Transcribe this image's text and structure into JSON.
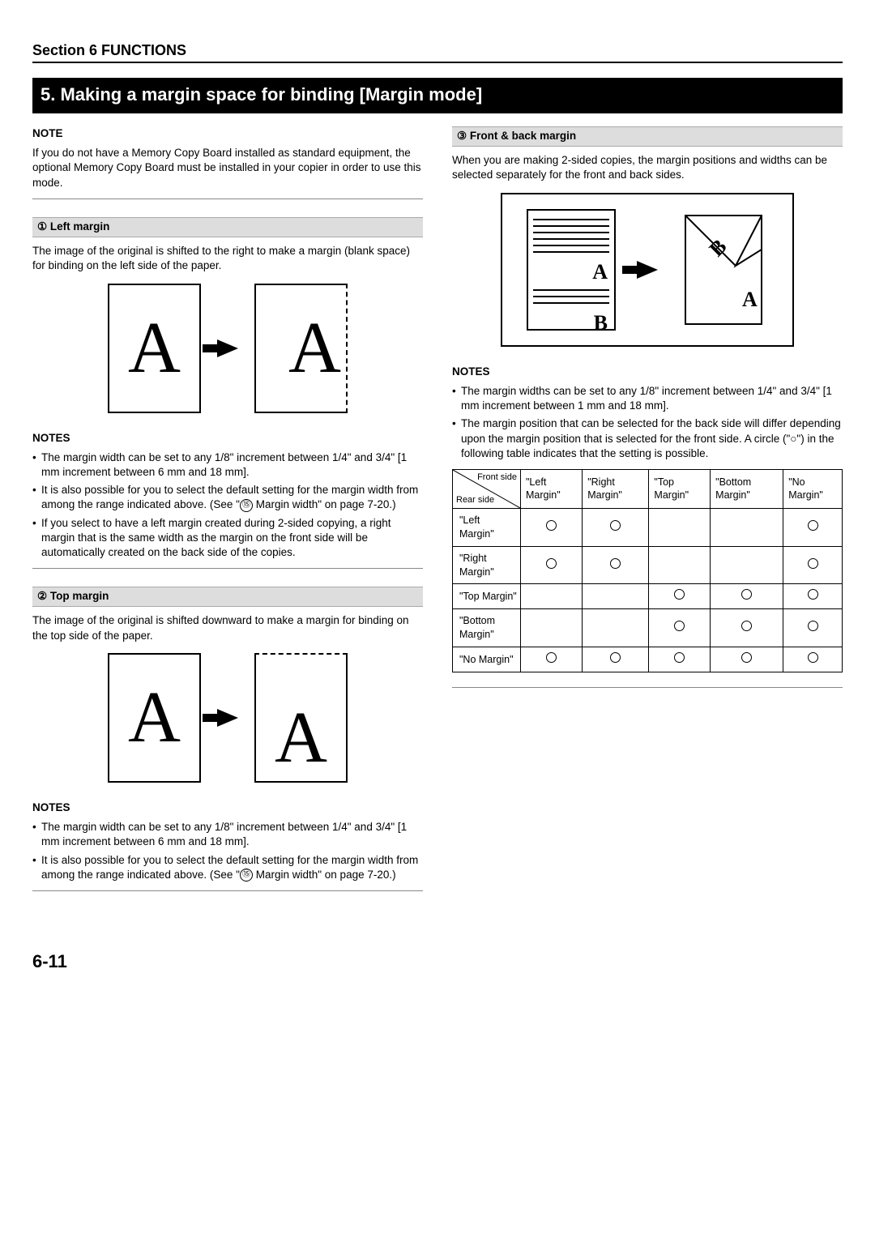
{
  "header": {
    "section": "Section 6  FUNCTIONS"
  },
  "title": "5.   Making a margin space for binding [Margin mode]",
  "left": {
    "note_head": "NOTE",
    "note_body": "If you do not have a Memory Copy Board installed as standard equipment, the optional Memory Copy Board must be installed in your copier in order to use this mode.",
    "s1_title": "①  Left margin",
    "s1_body": "The image of the original is shifted to the right to make a margin (blank space) for binding on the left side of the paper.",
    "s1_notes_head": "NOTES",
    "s1_n1": "The margin width can be set to any 1/8\" increment between 1/4\" and 3/4\" [1 mm increment between 6 mm and 18 mm].",
    "s1_n2a": "It is also possible for you to select the default setting for the margin width from among the range indicated above. (See \"",
    "s1_n2_ref": "⑮",
    "s1_n2b": " Margin width\" on page 7-20.)",
    "s1_n3": "If you select to have a left margin created during 2-sided copying, a right margin that is the same width as the margin on the front side will be automatically created on the back side of the copies.",
    "s2_title": "②  Top margin",
    "s2_body": "The image of the original is shifted downward to make a margin for binding on the top side of the paper.",
    "s2_notes_head": "NOTES",
    "s2_n1": "The margin width can be set to any 1/8\" increment between 1/4\" and 3/4\" [1 mm increment between 6 mm and 18 mm].",
    "s2_n2a": "It is also possible for you to select the default setting for the margin width from among the range indicated above. (See \"",
    "s2_n2_ref": "⑮",
    "s2_n2b": " Margin width\" on page 7-20.)"
  },
  "right": {
    "s3_title": "③ Front & back margin",
    "s3_body": "When you are making 2-sided copies, the margin positions and widths can be selected separately for the front and back sides.",
    "notes_head": "NOTES",
    "n1": "The margin widths can be set to any 1/8\" increment between 1/4\" and 3/4\" [1 mm increment between 1 mm and 18 mm].",
    "n2": "The margin position that can be selected for the back side will differ depending upon the margin position that is selected for the front side. A circle (\"○\") in the following table indicates that the setting is possible.",
    "diag_top": "Front side",
    "diag_bot": "Rear side",
    "cols": [
      "\"Left Margin\"",
      "\"Right Margin\"",
      "\"Top Margin\"",
      "\"Bottom Margin\"",
      "\"No Margin\""
    ],
    "rows": [
      "\"Left Margin\"",
      "\"Right Margin\"",
      "\"Top Margin\"",
      "\"Bottom Margin\"",
      "\"No Margin\""
    ]
  },
  "pagenum": "6-11",
  "chart_data": {
    "type": "table",
    "title": "Selectable rear-side margin position for each front-side margin position (○ = possible)",
    "columns": [
      "Left Margin",
      "Right Margin",
      "Top Margin",
      "Bottom Margin",
      "No Margin"
    ],
    "rows": [
      "Left Margin",
      "Right Margin",
      "Top Margin",
      "Bottom Margin",
      "No Margin"
    ],
    "matrix": [
      [
        1,
        1,
        0,
        0,
        1
      ],
      [
        1,
        1,
        0,
        0,
        1
      ],
      [
        0,
        0,
        1,
        1,
        1
      ],
      [
        0,
        0,
        1,
        1,
        1
      ],
      [
        1,
        1,
        1,
        1,
        1
      ]
    ]
  }
}
